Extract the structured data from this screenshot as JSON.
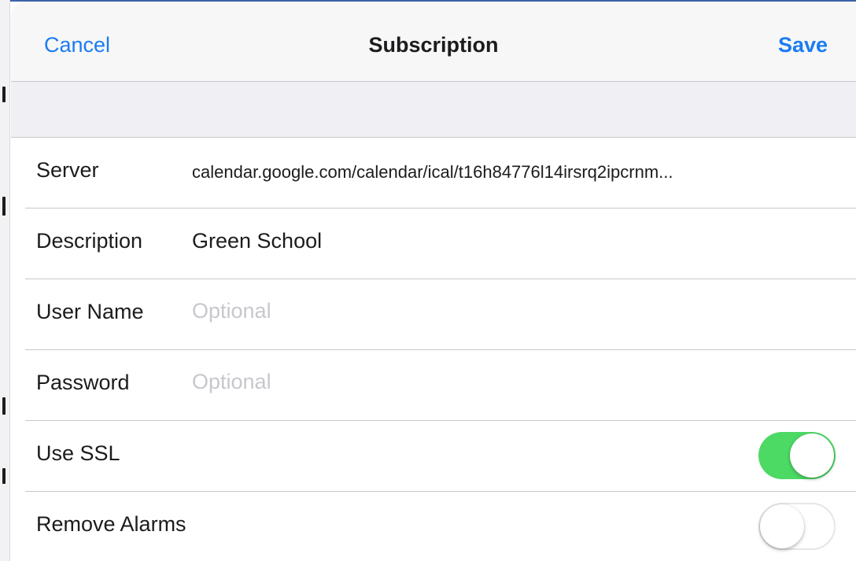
{
  "navbar": {
    "cancel_label": "Cancel",
    "title": "Subscription",
    "save_label": "Save"
  },
  "form": {
    "server": {
      "label": "Server",
      "value": "calendar.google.com/calendar/ical/t16h84776l14irsrq2ipcrnm..."
    },
    "description": {
      "label": "Description",
      "value": "Green School"
    },
    "username": {
      "label": "User Name",
      "value": "",
      "placeholder": "Optional"
    },
    "password": {
      "label": "Password",
      "value": "",
      "placeholder": "Optional"
    },
    "use_ssl": {
      "label": "Use SSL",
      "enabled": true
    },
    "remove_alarms": {
      "label": "Remove Alarms",
      "enabled": false
    }
  },
  "colors": {
    "accent": "#1a7cf3",
    "toggle_on": "#4cd964",
    "separator": "#c8c7cc",
    "group_background": "#efeff4"
  }
}
